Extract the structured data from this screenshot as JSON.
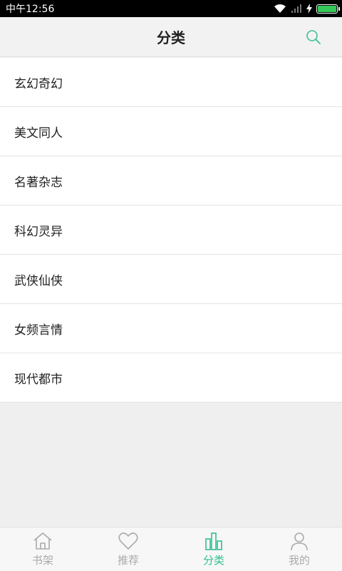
{
  "status_bar": {
    "time": "中午12:56"
  },
  "header": {
    "title": "分类",
    "search_icon": "search-icon"
  },
  "categories": [
    {
      "label": "玄幻奇幻"
    },
    {
      "label": "美文同人"
    },
    {
      "label": "名著杂志"
    },
    {
      "label": "科幻灵异"
    },
    {
      "label": "武侠仙侠"
    },
    {
      "label": "女频言情"
    },
    {
      "label": "现代都市"
    }
  ],
  "tabbar": {
    "tabs": [
      {
        "label": "书架",
        "icon": "home-icon"
      },
      {
        "label": "推荐",
        "icon": "heart-icon"
      },
      {
        "label": "分类",
        "icon": "category-bars-icon"
      },
      {
        "label": "我的",
        "icon": "user-icon"
      }
    ],
    "active_color": "#2fbf92",
    "inactive_color": "#aaaaaa"
  }
}
